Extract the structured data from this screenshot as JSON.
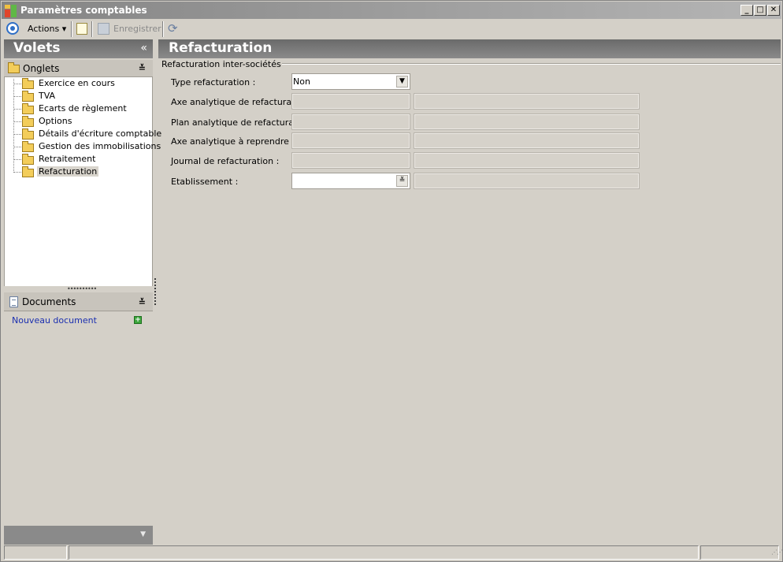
{
  "window": {
    "title": "Paramètres comptables"
  },
  "titlebar_buttons": {
    "minimize": "_",
    "maximize": "□",
    "close": "✕"
  },
  "toolbar": {
    "actions_label": "Actions",
    "actions_caret": "▾",
    "save_label": "Enregistrer",
    "refresh_glyph": "⟳"
  },
  "left": {
    "volets_title": "Volets",
    "volets_collapse": "«",
    "onglets_title": "Onglets",
    "chev_up": "≚",
    "tree": [
      {
        "label": "Exercice en cours",
        "selected": false
      },
      {
        "label": "TVA",
        "selected": false
      },
      {
        "label": "Ecarts de règlement",
        "selected": false
      },
      {
        "label": "Options",
        "selected": false
      },
      {
        "label": "Détails d'écriture comptable",
        "selected": false
      },
      {
        "label": "Gestion des immobilisations",
        "selected": false
      },
      {
        "label": "Retraitement",
        "selected": false
      },
      {
        "label": "Refacturation",
        "selected": true
      }
    ],
    "documents_title": "Documents",
    "new_document_label": "Nouveau document",
    "add_glyph": "+",
    "bottom_arrow": "▼"
  },
  "main": {
    "title": "Refacturation",
    "group_title": "Refacturation inter-sociétés",
    "fields": {
      "type_refacturation": {
        "label": "Type refacturation :",
        "value": "Non",
        "dropdown_glyph": "▼"
      },
      "axe_analytique_refacturation": {
        "label": "Axe analytique de refacturation :"
      },
      "plan_analytique_refacturation": {
        "label": "Plan analytique de refacturation"
      },
      "axe_analytique_reprendre": {
        "label": "Axe analytique à reprendre :"
      },
      "journal_refacturation": {
        "label": "Journal de refacturation :"
      },
      "etablissement": {
        "label": "Etablissement :",
        "value": "",
        "dropdown_glyph": "≚"
      }
    }
  },
  "icons": {
    "app": "app-icon",
    "actions": "circle-target-icon",
    "new": "new-document-icon",
    "save": "save-icon",
    "refresh": "refresh-icon",
    "folder": "folder-icon",
    "document": "document-icon",
    "add": "add-icon"
  },
  "colors": {
    "header_gradient_start": "#6a6a6a",
    "header_gradient_end": "#8a8a8a",
    "link": "#1b2fb0",
    "background": "#d4d0c8"
  }
}
